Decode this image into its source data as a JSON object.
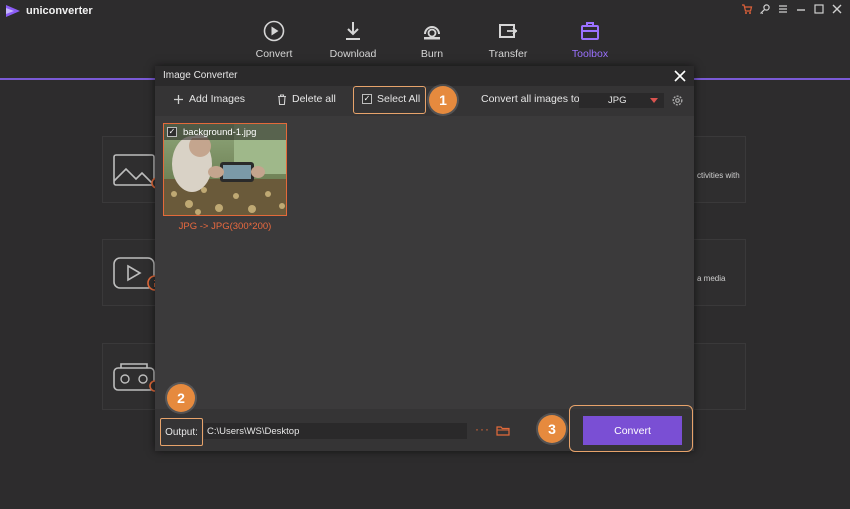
{
  "app": {
    "name": "uniconverter"
  },
  "nav": [
    {
      "label": "Convert",
      "icon": "convert-icon"
    },
    {
      "label": "Download",
      "icon": "download-icon"
    },
    {
      "label": "Burn",
      "icon": "burn-icon"
    },
    {
      "label": "Transfer",
      "icon": "transfer-icon"
    },
    {
      "label": "Toolbox",
      "icon": "toolbox-icon",
      "active": true
    }
  ],
  "background_cards": [
    {
      "partial_text": "ctivities with",
      "icon": "image-icon"
    },
    {
      "partial_text": "a media",
      "icon": "video-info-icon"
    },
    {
      "partial_text": "",
      "icon": "vr-icon"
    }
  ],
  "modal": {
    "title": "Image Converter",
    "toolbar": {
      "add_images": "Add Images",
      "delete_all": "Delete all",
      "select_all": "Select All",
      "convert_all_label": "Convert all images to:",
      "format_value": "JPG"
    },
    "files": [
      {
        "name": "background-1.jpg",
        "caption": "JPG -> JPG(300*200)",
        "checked": true
      }
    ],
    "output": {
      "label": "Output:",
      "path": "C:\\Users\\WS\\Desktop",
      "more": "···"
    },
    "convert_button": "Convert"
  },
  "badges": [
    "1",
    "2",
    "3"
  ],
  "colors": {
    "accent": "#7a4fd4",
    "highlight": "#e68a3e",
    "error_text": "#ea6a3f"
  }
}
